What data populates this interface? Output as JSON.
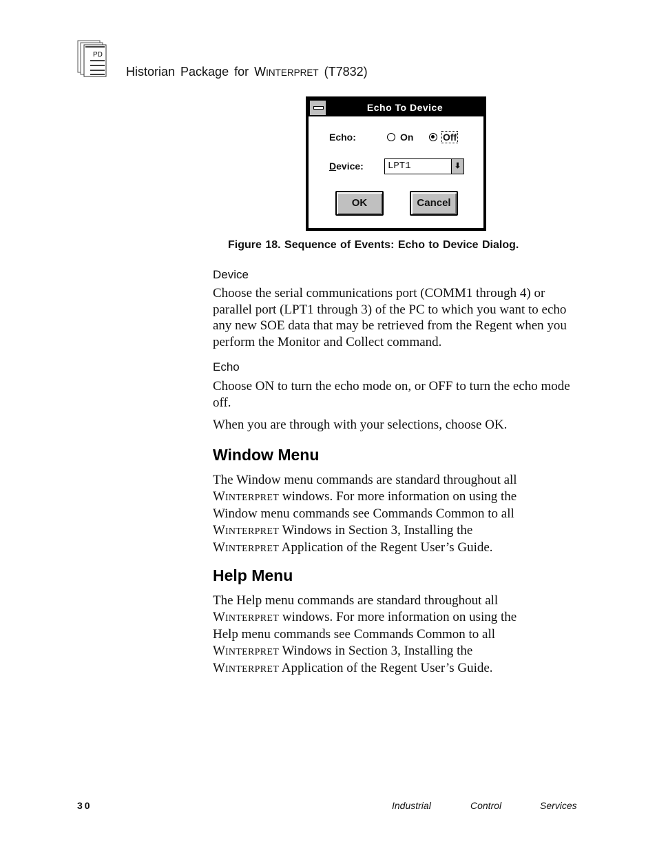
{
  "header": {
    "logo_text": "PD",
    "title_prefix": "Historian Package for ",
    "title_product_initial": "W",
    "title_product_rest": "INTERPRET",
    "title_suffix": " (T7832)"
  },
  "dialog": {
    "title": "Echo To Device",
    "echo_label": "Echo:",
    "radio_on_label": "On",
    "radio_off_label": "Off",
    "echo_selected": "Off",
    "device_label_accel": "D",
    "device_label_rest": "evice:",
    "device_value": "LPT1",
    "dropdown_glyph": "⬇",
    "ok_label": "OK",
    "cancel_label": "Cancel"
  },
  "figure_caption": "Figure 18.  Sequence of Events: Echo to Device Dialog.",
  "sections": {
    "device": {
      "heading": "Device",
      "text": "Choose the serial communications port (COMM1 through 4) or parallel port (LPT1 through 3) of the PC to which you want to echo any new SOE data that may be retrieved from the Regent when you perform the Monitor and Collect command."
    },
    "echo": {
      "heading": "Echo",
      "text": "Choose ON to turn the echo mode on, or OFF to turn the echo mode off.",
      "text2": "When you are through with your selections, choose OK."
    },
    "window_menu": {
      "heading": "Window Menu",
      "line1": "The Window menu commands are standard throughout all",
      "line2_rest": " windows.  For more information on using the",
      "line3": "Window menu commands see Commands Common to all",
      "line4_rest": " Windows in Section 3, Installing the",
      "line5_rest": " Application of the Regent User’s Guide."
    },
    "help_menu": {
      "heading": "Help Menu",
      "line1": "The Help menu commands are standard throughout all",
      "line2_rest": " windows.  For more information on using the",
      "line3": "Help menu commands see Commands Common to all",
      "line4_rest": " Windows in Section 3, Installing the",
      "line5_rest": " Application of the Regent User’s Guide."
    },
    "product_initial": "W",
    "product_rest": "INTERPRET"
  },
  "footer": {
    "page_number": "30",
    "company_word1": "Industrial",
    "company_word2": "Control",
    "company_word3": "Services"
  }
}
